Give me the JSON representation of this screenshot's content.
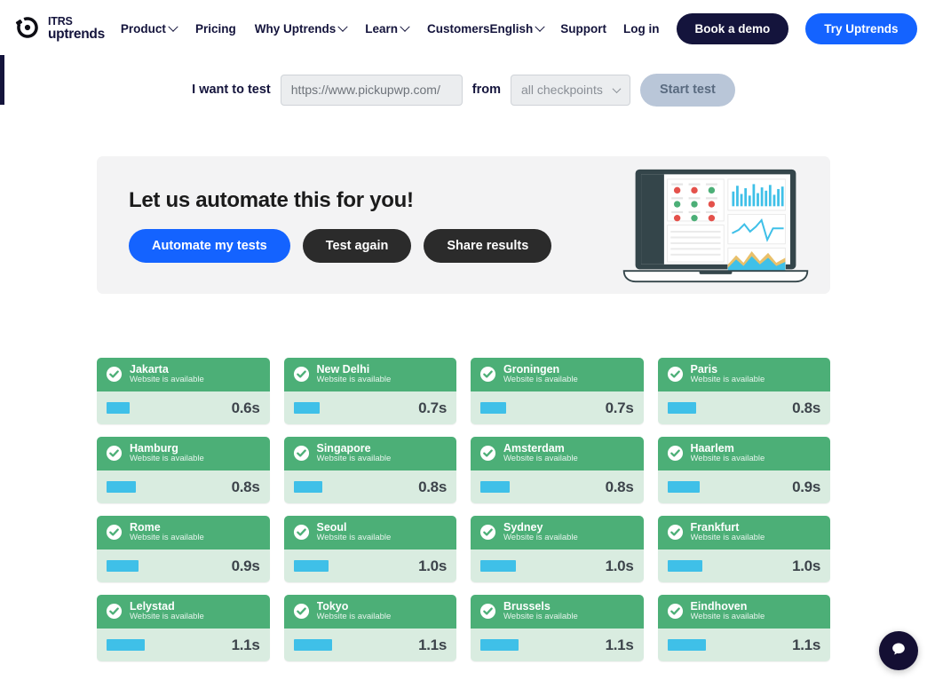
{
  "header": {
    "brand": {
      "line1": "ITRS",
      "line2": "uptrends",
      "logo_icon": "itrs-cog-logo"
    },
    "nav": [
      {
        "label": "Product",
        "has_chevron": true
      },
      {
        "label": "Pricing",
        "has_chevron": false
      },
      {
        "label": "Why Uptrends",
        "has_chevron": true
      },
      {
        "label": "Learn",
        "has_chevron": true
      },
      {
        "label": "Customers",
        "has_chevron": false
      }
    ],
    "right": {
      "language": "English",
      "support": "Support",
      "login": "Log in",
      "demo_button": "Book a demo",
      "try_button": "Try Uptrends"
    }
  },
  "testbar": {
    "label": "I want to test",
    "url_value": "https://www.pickupwp.com/",
    "url_placeholder": "https://www.pickupwp.com/",
    "from_label": "from",
    "checkpoint_selected": "all checkpoints",
    "checkpoint_options": [
      "all checkpoints"
    ],
    "start_button": "Start test"
  },
  "promo": {
    "title": "Let us automate this for you!",
    "buttons": [
      {
        "label": "Automate my tests",
        "style": "blue"
      },
      {
        "label": "Test again",
        "style": "dark"
      },
      {
        "label": "Share results",
        "style": "dark"
      }
    ],
    "illustration": "laptop-dashboard-illustration"
  },
  "results": {
    "status_text": "Website is available",
    "cards": [
      {
        "city": "Jakarta",
        "time": "0.6s",
        "bar_pct": 15
      },
      {
        "city": "New Delhi",
        "time": "0.7s",
        "bar_pct": 17
      },
      {
        "city": "Groningen",
        "time": "0.7s",
        "bar_pct": 17
      },
      {
        "city": "Paris",
        "time": "0.8s",
        "bar_pct": 19
      },
      {
        "city": "Hamburg",
        "time": "0.8s",
        "bar_pct": 19
      },
      {
        "city": "Singapore",
        "time": "0.8s",
        "bar_pct": 19
      },
      {
        "city": "Amsterdam",
        "time": "0.8s",
        "bar_pct": 19
      },
      {
        "city": "Haarlem",
        "time": "0.9s",
        "bar_pct": 21
      },
      {
        "city": "Rome",
        "time": "0.9s",
        "bar_pct": 21
      },
      {
        "city": "Seoul",
        "time": "1.0s",
        "bar_pct": 23
      },
      {
        "city": "Sydney",
        "time": "1.0s",
        "bar_pct": 23
      },
      {
        "city": "Frankfurt",
        "time": "1.0s",
        "bar_pct": 23
      },
      {
        "city": "Lelystad",
        "time": "1.1s",
        "bar_pct": 25
      },
      {
        "city": "Tokyo",
        "time": "1.1s",
        "bar_pct": 25
      },
      {
        "city": "Brussels",
        "time": "1.1s",
        "bar_pct": 25
      },
      {
        "city": "Eindhoven",
        "time": "1.1s",
        "bar_pct": 25
      }
    ]
  },
  "chat": {
    "icon": "chat-bubble-icon"
  },
  "colors": {
    "brand_navy": "#14143c",
    "accent_blue": "#1463ff",
    "card_header_green": "#4caf77",
    "card_body_green": "#d9ece0",
    "bar_cyan": "#3fc0e8",
    "disabled_button": "#b9c6d8"
  }
}
